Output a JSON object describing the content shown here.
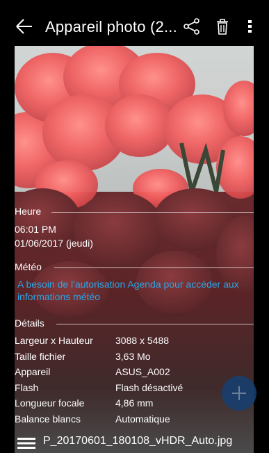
{
  "header": {
    "title": "Appareil photo (2...",
    "back_icon": "arrow-left-icon",
    "share_icon": "share-icon",
    "delete_icon": "trash-icon",
    "more_icon": "more-vert-icon"
  },
  "info": {
    "time": {
      "heading": "Heure",
      "time": "06:01 PM",
      "date": "01/06/2017 (jeudi)"
    },
    "weather": {
      "heading": "Météo",
      "message": "A besoin de l'autorisation Agenda pour accéder aux informations météo"
    },
    "details": {
      "heading": "Détails",
      "rows": [
        {
          "label": "Largeur x Hauteur",
          "value": "3088 x 5488"
        },
        {
          "label": "Taille fichier",
          "value": "3,63 Mo"
        },
        {
          "label": "Appareil",
          "value": "ASUS_A002"
        },
        {
          "label": "Flash",
          "value": "Flash désactivé"
        },
        {
          "label": "Longueur focale",
          "value": "4,86 mm"
        },
        {
          "label": "Balance blancs",
          "value": "Automatique"
        }
      ]
    }
  },
  "footer": {
    "file_name": "P_20170601_180108_vHDR_Auto.jpg",
    "menu_icon": "hamburger-menu-icon"
  },
  "fab": {
    "icon": "plus-icon"
  },
  "colors": {
    "link": "#2ba6e8",
    "fab": "#164073"
  }
}
